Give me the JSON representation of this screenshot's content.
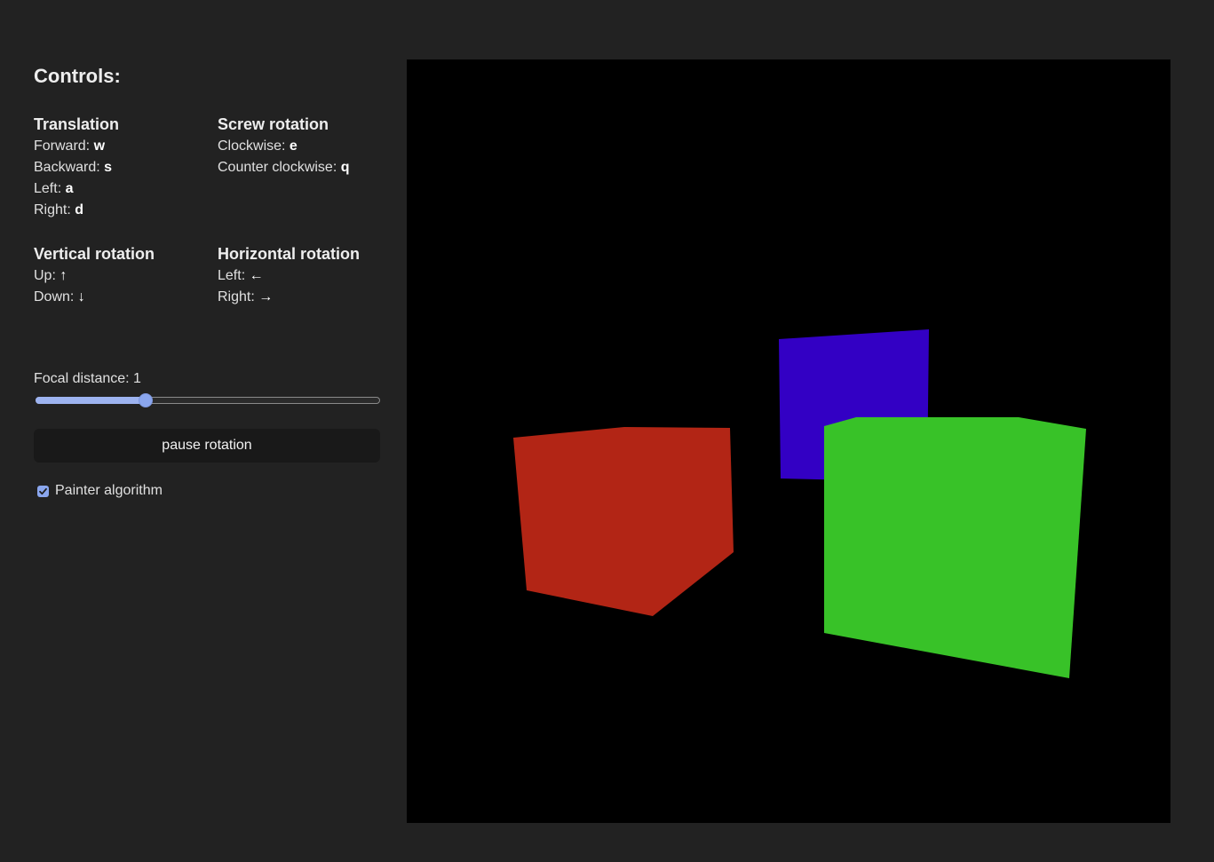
{
  "controls": {
    "title": "Controls:",
    "groups": [
      {
        "title": "Translation",
        "rows": [
          {
            "label": "Forward: ",
            "key": "w"
          },
          {
            "label": "Backward: ",
            "key": "s"
          },
          {
            "label": "Left: ",
            "key": "a"
          },
          {
            "label": "Right: ",
            "key": "d"
          }
        ]
      },
      {
        "title": "Screw rotation",
        "rows": [
          {
            "label": "Clockwise: ",
            "key": "e"
          },
          {
            "label": "Counter clockwise: ",
            "key": "q"
          }
        ]
      },
      {
        "title": "Vertical rotation",
        "rows": [
          {
            "label": "Up: ",
            "key": "↑"
          },
          {
            "label": "Down: ",
            "key": "↓"
          }
        ]
      },
      {
        "title": "Horizontal rotation",
        "rows": [
          {
            "label": "Left: ",
            "key": "←"
          },
          {
            "label": "Right: ",
            "key": "→"
          }
        ]
      }
    ]
  },
  "focal": {
    "label": "Focal distance: 1",
    "value_fraction": 0.32
  },
  "pause_button": {
    "label": "pause rotation"
  },
  "painter": {
    "label": "Painter algorithm",
    "checked": true
  },
  "scene": {
    "background": "#000000",
    "cube_colors": {
      "red": "#b22515",
      "blue": "#3300c4",
      "green": "#38c228"
    }
  },
  "theme": {
    "accent": "#8aa6ee",
    "page_bg": "#222222"
  }
}
